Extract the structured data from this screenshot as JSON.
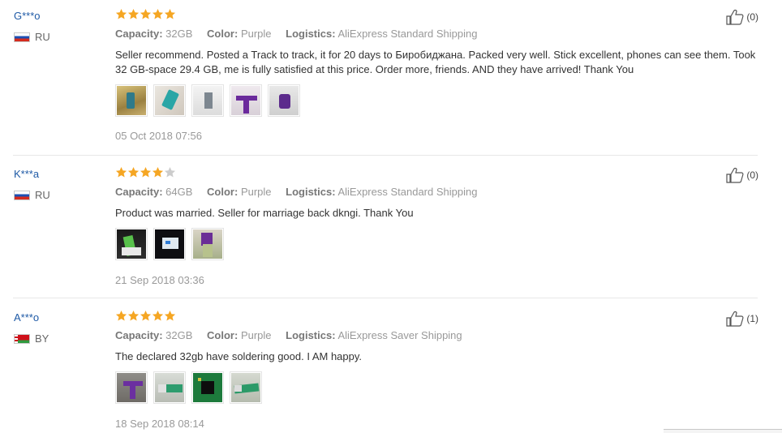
{
  "colors": {
    "star": "#f5a623",
    "star_empty": "#cccccc",
    "username": "#1f5aa6",
    "muted": "#999999"
  },
  "reviews": [
    {
      "user": "G***o",
      "country": "RU",
      "flag": "ru-flag-icon",
      "rating": 5,
      "meta": {
        "capacity_label": "Capacity:",
        "capacity": "32GB",
        "color_label": "Color:",
        "color": "Purple",
        "logistics_label": "Logistics:",
        "logistics": "AliExpress Standard Shipping"
      },
      "text": "Seller recommend. Posted a Track to track, it for 20 days to Биробиджана. Packed very well. Stick excellent, phones can see them. Took 32 GB-space 29.4 GB, me is fully satisfied at this price. Order more, friends. AND they have arrived! Thank You",
      "photo_count": 5,
      "date": "05 Oct 2018 07:56",
      "likes": "(0)"
    },
    {
      "user": "K***a",
      "country": "RU",
      "flag": "ru-flag-icon",
      "rating": 4,
      "meta": {
        "capacity_label": "Capacity:",
        "capacity": "64GB",
        "color_label": "Color:",
        "color": "Purple",
        "logistics_label": "Logistics:",
        "logistics": "AliExpress Standard Shipping"
      },
      "text": "Product was married. Seller for marriage back dkngi. Thank You",
      "photo_count": 3,
      "date": "21 Sep 2018 03:36",
      "likes": "(0)"
    },
    {
      "user": "A***o",
      "country": "BY",
      "flag": "by-flag-icon",
      "rating": 5,
      "meta": {
        "capacity_label": "Capacity:",
        "capacity": "32GB",
        "color_label": "Color:",
        "color": "Purple",
        "logistics_label": "Logistics:",
        "logistics": "AliExpress Saver Shipping"
      },
      "text": "The declared 32gb have soldering good. I AM happy.",
      "photo_count": 4,
      "date": "18 Sep 2018 08:14",
      "likes": "(1)"
    }
  ]
}
